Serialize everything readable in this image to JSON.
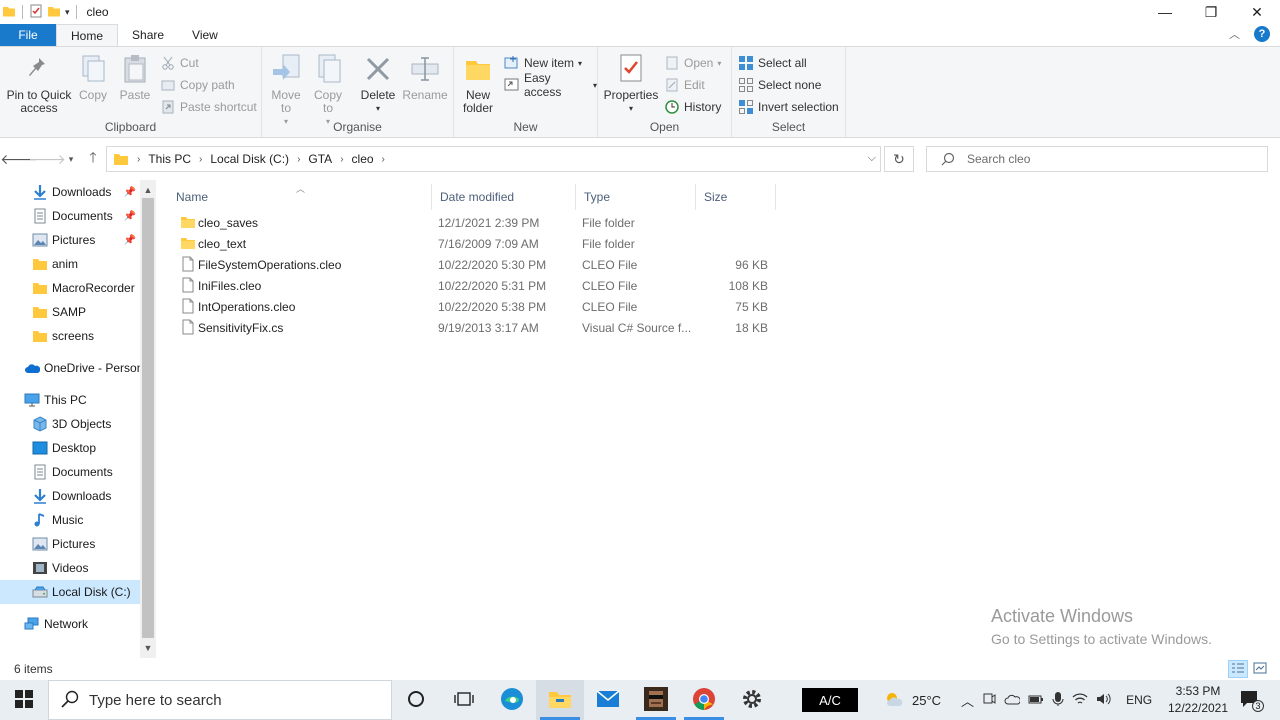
{
  "window": {
    "title": "cleo",
    "minimize": "—",
    "maximize": "❐",
    "close": "✕"
  },
  "tabs": {
    "file": "File",
    "home": "Home",
    "share": "Share",
    "view": "View"
  },
  "ribbon": {
    "clipboard": {
      "label": "Clipboard",
      "pin": "Pin to Quick\naccess",
      "copy": "Copy",
      "paste": "Paste",
      "cut": "Cut",
      "copy_path": "Copy path",
      "paste_shortcut": "Paste shortcut"
    },
    "organise": {
      "label": "Organise",
      "move_to": "Move\nto",
      "copy_to": "Copy\nto",
      "delete": "Delete",
      "rename": "Rename"
    },
    "new": {
      "label": "New",
      "new_folder": "New\nfolder",
      "new_item": "New item",
      "easy_access": "Easy access"
    },
    "open": {
      "label": "Open",
      "properties": "Properties",
      "open": "Open",
      "edit": "Edit",
      "history": "History"
    },
    "select": {
      "label": "Select",
      "select_all": "Select all",
      "select_none": "Select none",
      "invert": "Invert selection"
    }
  },
  "address": {
    "crumbs": [
      "This PC",
      "Local Disk (C:)",
      "GTA",
      "cleo"
    ],
    "search_placeholder": "Search cleo"
  },
  "nav": {
    "quick": [
      {
        "label": "Downloads",
        "icon": "download-arrow-icon"
      },
      {
        "label": "Documents",
        "icon": "document-icon"
      },
      {
        "label": "Pictures",
        "icon": "pictures-icon"
      },
      {
        "label": "anim",
        "icon": "folder-icon"
      },
      {
        "label": "MacroRecorder",
        "icon": "folder-icon"
      },
      {
        "label": "SAMP",
        "icon": "folder-icon"
      },
      {
        "label": "screens",
        "icon": "folder-icon"
      }
    ],
    "onedrive": "OneDrive - Person",
    "this_pc": "This PC",
    "pc_items": [
      {
        "label": "3D Objects"
      },
      {
        "label": "Desktop"
      },
      {
        "label": "Documents"
      },
      {
        "label": "Downloads"
      },
      {
        "label": "Music"
      },
      {
        "label": "Pictures"
      },
      {
        "label": "Videos"
      },
      {
        "label": "Local Disk (C:)"
      }
    ],
    "network": "Network"
  },
  "columns": {
    "name": "Name",
    "date": "Date modified",
    "type": "Type",
    "size": "Size"
  },
  "files": [
    {
      "name": "cleo_saves",
      "date": "12/1/2021 2:39 PM",
      "type": "File folder",
      "size": "",
      "kind": "folder"
    },
    {
      "name": "cleo_text",
      "date": "7/16/2009 7:09 AM",
      "type": "File folder",
      "size": "",
      "kind": "folder"
    },
    {
      "name": "FileSystemOperations.cleo",
      "date": "10/22/2020 5:30 PM",
      "type": "CLEO File",
      "size": "96 KB",
      "kind": "file"
    },
    {
      "name": "IniFiles.cleo",
      "date": "10/22/2020 5:31 PM",
      "type": "CLEO File",
      "size": "108 KB",
      "kind": "file"
    },
    {
      "name": "IntOperations.cleo",
      "date": "10/22/2020 5:38 PM",
      "type": "CLEO File",
      "size": "75 KB",
      "kind": "file"
    },
    {
      "name": "SensitivityFix.cs",
      "date": "9/19/2013 3:17 AM",
      "type": "Visual C# Source f...",
      "size": "18 KB",
      "kind": "file"
    }
  ],
  "watermark": {
    "line1": "Activate Windows",
    "line2": "Go to Settings to activate Windows."
  },
  "status": {
    "items": "6 items"
  },
  "taskbar": {
    "search_placeholder": "Type here to search",
    "ac": "A/C",
    "temp": "25°C",
    "lang": "ENG",
    "time": "3:53 PM",
    "date": "12/22/2021",
    "notif_count": "3"
  },
  "colors": {
    "accent": "#1979ca",
    "folder": "#ffc83d",
    "selection": "#cce8ff"
  }
}
